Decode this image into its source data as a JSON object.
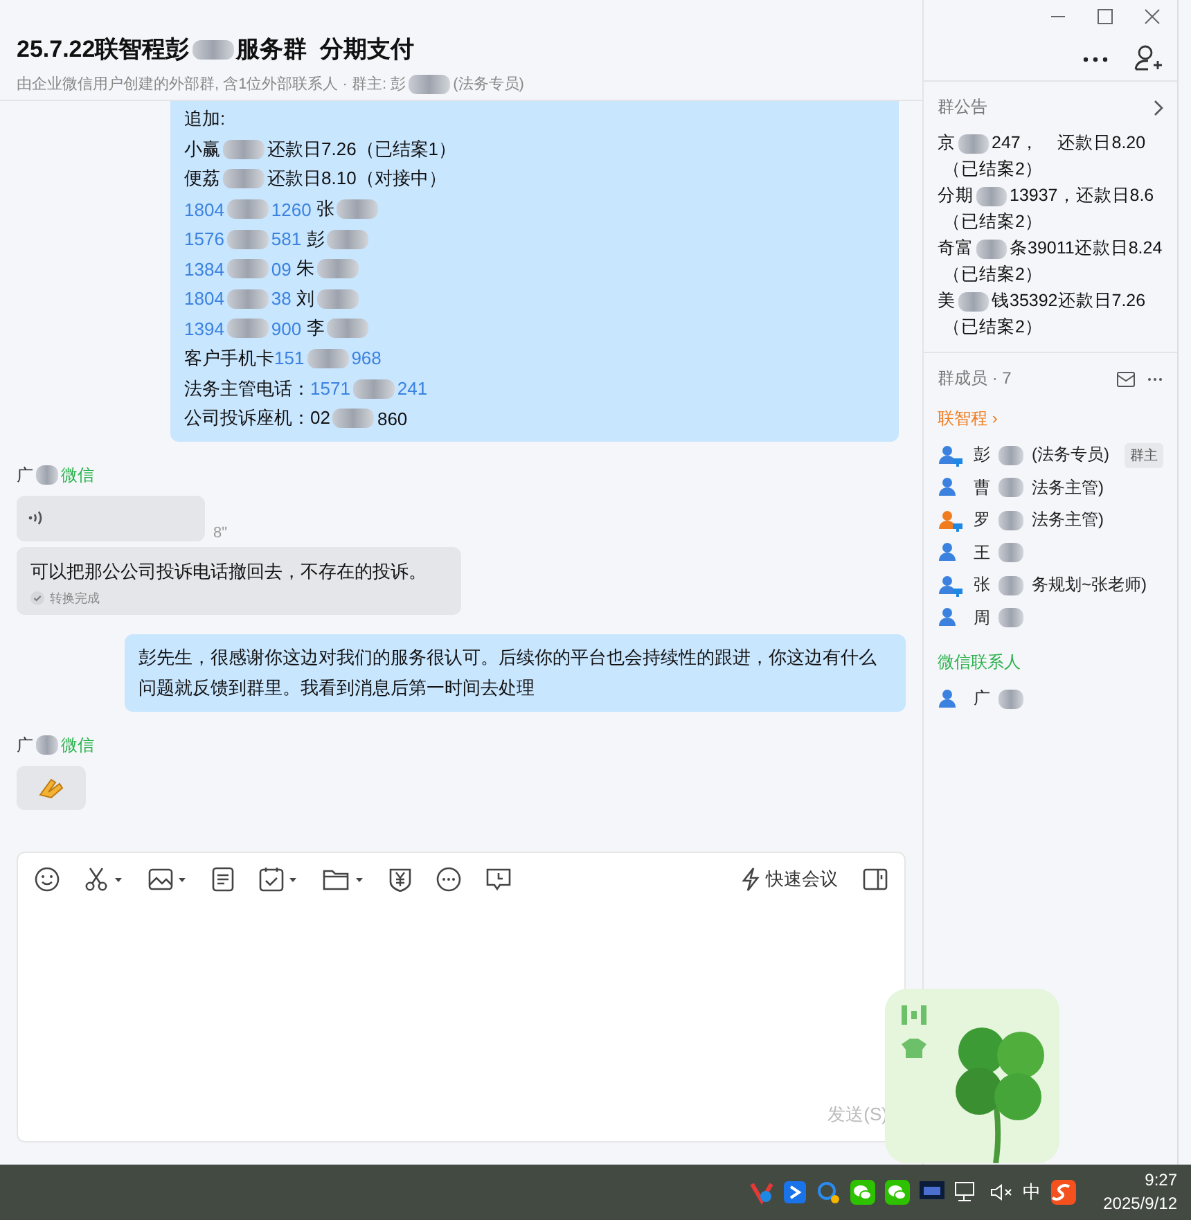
{
  "header": {
    "title": [
      {
        "kind": "text",
        "text": "25.7.22联智程彭"
      },
      {
        "kind": "blur"
      },
      {
        "kind": "text",
        "text": "服务群  分期支付"
      }
    ],
    "subtitle": [
      {
        "kind": "text",
        "text": "由企业微信用户创建的外部群, 含1位外部联系人 · 群主: 彭"
      },
      {
        "kind": "blur"
      },
      {
        "kind": "text",
        "text": "(法务专员)"
      }
    ]
  },
  "messages": [
    {
      "kind": "mine-text",
      "lines": [
        [
          {
            "kind": "text",
            "text": "追加:"
          }
        ],
        [
          {
            "kind": "text",
            "text": "小赢"
          },
          {
            "kind": "blur"
          },
          {
            "kind": "text",
            "text": "还款日7.26（已结案1）"
          }
        ],
        [
          {
            "kind": "text",
            "text": "便荔"
          },
          {
            "kind": "blur"
          },
          {
            "kind": "text",
            "text": "还款日8.10（对接中）"
          }
        ],
        [
          {
            "kind": "link",
            "text": "1804"
          },
          {
            "kind": "blur"
          },
          {
            "kind": "link",
            "text": "1260"
          },
          {
            "kind": "text",
            "text": " 张"
          },
          {
            "kind": "blur"
          }
        ],
        [
          {
            "kind": "link",
            "text": "1576"
          },
          {
            "kind": "blur"
          },
          {
            "kind": "link",
            "text": "581"
          },
          {
            "kind": "text",
            "text": " 彭"
          },
          {
            "kind": "blur"
          }
        ],
        [
          {
            "kind": "link",
            "text": "1384"
          },
          {
            "kind": "blur"
          },
          {
            "kind": "link",
            "text": "09"
          },
          {
            "kind": "text",
            "text": " 朱"
          },
          {
            "kind": "blur"
          }
        ],
        [
          {
            "kind": "link",
            "text": "1804"
          },
          {
            "kind": "blur"
          },
          {
            "kind": "link",
            "text": "38"
          },
          {
            "kind": "text",
            "text": " 刘"
          },
          {
            "kind": "blur"
          }
        ],
        [
          {
            "kind": "link",
            "text": "1394"
          },
          {
            "kind": "blur"
          },
          {
            "kind": "link",
            "text": "900"
          },
          {
            "kind": "text",
            "text": " 李"
          },
          {
            "kind": "blur"
          }
        ],
        [
          {
            "kind": "text",
            "text": "客户手机卡"
          },
          {
            "kind": "link",
            "text": "151"
          },
          {
            "kind": "blur"
          },
          {
            "kind": "link",
            "text": "968"
          }
        ],
        [
          {
            "kind": "text",
            "text": "法务主管电话："
          },
          {
            "kind": "link",
            "text": "1571"
          },
          {
            "kind": "blur"
          },
          {
            "kind": "link",
            "text": "241"
          }
        ],
        [
          {
            "kind": "text",
            "text": "公司投诉座机：02"
          },
          {
            "kind": "blur"
          },
          {
            "kind": "text",
            "text": "860"
          }
        ]
      ]
    },
    {
      "kind": "sender",
      "name": "广",
      "source": "微信"
    },
    {
      "kind": "voice",
      "duration": "8\""
    },
    {
      "kind": "transcript",
      "text": "可以把那公公司投诉电话撤回去，不存在的投诉。",
      "status": "转换完成"
    },
    {
      "kind": "mine-plain",
      "text": "彭先生，很感谢你这边对我们的服务很认可。后续你的平台也会持续性的跟进，你这边有什么问题就反馈到群里。我看到消息后第一时间去处理"
    },
    {
      "kind": "sender",
      "name": "广",
      "source": "微信"
    },
    {
      "kind": "sticker"
    }
  ],
  "composer": {
    "meeting": "快速会议",
    "send": "发送(S)"
  },
  "sidebar": {
    "notice_title": "群公告",
    "notices": [
      {
        "parts": [
          {
            "kind": "text",
            "text": "京"
          },
          {
            "kind": "blur"
          },
          {
            "kind": "text",
            "text": "247，    还款日8.20"
          }
        ],
        "status": "（已结案2）"
      },
      {
        "parts": [
          {
            "kind": "text",
            "text": "分期"
          },
          {
            "kind": "blur"
          },
          {
            "kind": "text",
            "text": "13937，还款日8.6"
          }
        ],
        "status": "（已结案2）"
      },
      {
        "parts": [
          {
            "kind": "text",
            "text": "奇富"
          },
          {
            "kind": "blur"
          },
          {
            "kind": "text",
            "text": "条39011还款日8.24"
          }
        ],
        "status": "（已结案2）"
      },
      {
        "parts": [
          {
            "kind": "text",
            "text": "美"
          },
          {
            "kind": "blur"
          },
          {
            "kind": "text",
            "text": "钱35392还款日7.26"
          }
        ],
        "status": "（已结案2）"
      }
    ],
    "members_title": "群成员 · 7",
    "groups": [
      {
        "label": "联智程 ›",
        "color": "#f07c1e",
        "members": [
          {
            "name": "彭",
            "rest": "(法务专员)",
            "badge": "群主",
            "pc": true,
            "color": "#3b82e0"
          },
          {
            "name": "曹",
            "rest": "法务主管)",
            "pc": false,
            "color": "#3b82e0"
          },
          {
            "name": "罗",
            "rest": "法务主管)",
            "pc": true,
            "color": "#f07c1e"
          },
          {
            "name": "王",
            "pc": false,
            "color": "#3b82e0"
          },
          {
            "name": "张",
            "rest": "务规划~张老师)",
            "pc": true,
            "color": "#3b82e0"
          },
          {
            "name": "周",
            "pc": false,
            "color": "#3b82e0"
          }
        ]
      },
      {
        "label": "微信联系人",
        "color": "#2bb24c",
        "members": [
          {
            "name": "广",
            "pc": false,
            "color": "#3b82e0"
          }
        ]
      }
    ]
  },
  "taskbar": {
    "ime": "中",
    "time": "9:27",
    "date": "2025/9/12"
  }
}
